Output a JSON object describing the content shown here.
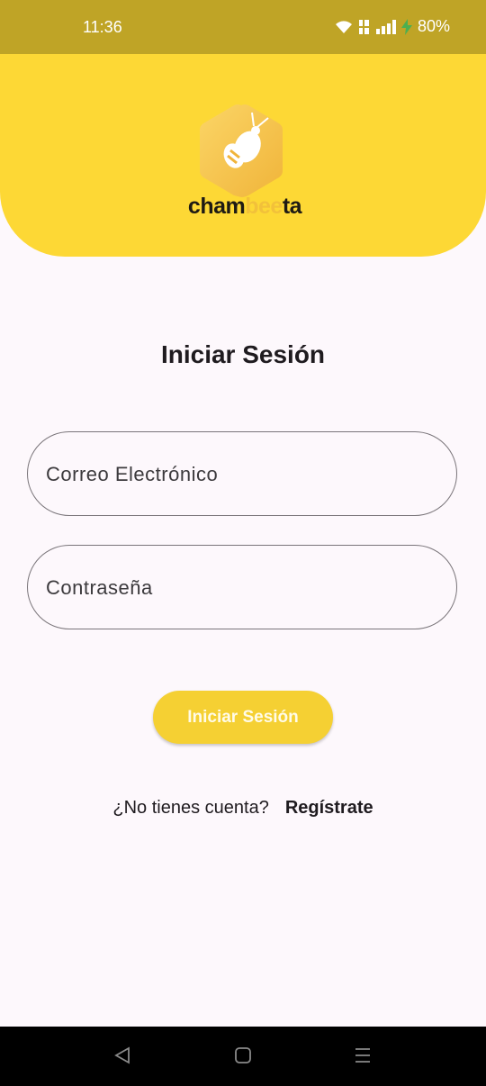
{
  "status_bar": {
    "time": "11:36",
    "battery": "80%",
    "icons": [
      "wifi-icon",
      "volte-icon",
      "signal-icon",
      "charging-icon"
    ]
  },
  "logo": {
    "text_dark_1": "cham",
    "text_light": "bee",
    "text_dark_2": "ta",
    "colors": {
      "hex": "#f5c84a",
      "bee": "#ffffff"
    }
  },
  "login": {
    "title": "Iniciar Sesión",
    "email_placeholder": "Correo Electrónico",
    "password_placeholder": "Contraseña",
    "submit_label": "Iniciar Sesión",
    "register_prompt": "¿No tienes cuenta?",
    "register_link": "Regístrate"
  },
  "nav_bar": {
    "icons": [
      "back-icon",
      "home-icon",
      "recents-icon"
    ]
  },
  "colors": {
    "header": "#fdd835",
    "status_bar": "#bfa426",
    "button": "#f5d033",
    "background": "#fdf8fc"
  }
}
